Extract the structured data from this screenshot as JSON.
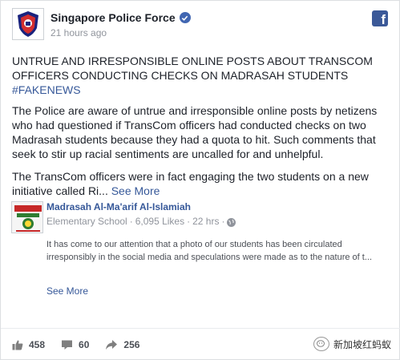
{
  "post": {
    "page_name": "Singapore Police Force",
    "timestamp": "21 hours ago",
    "headline": "UNTRUE AND IRRESPONSIBLE ONLINE POSTS ABOUT TRANSCOM OFFICERS CONDUCTING CHECKS ON MADRASAH STUDENTS",
    "hashtag": "#FAKENEWS",
    "paragraph1": "The Police are aware of untrue and irresponsible online posts by netizens who had questioned if TransCom officers had conducted checks on two Madrasah students because they had a quota to hit. Such comments that seek to stir up racial sentiments are uncalled for and unhelpful.",
    "paragraph2": "The TransCom officers were in fact engaging the two students on a new initiative called Ri...",
    "see_more": "See More",
    "icons": {
      "verified": "verified-badge-icon",
      "facebook": "facebook-logo-icon",
      "globe": "globe-icon",
      "like": "like-icon",
      "comment": "comment-icon",
      "share": "share-icon"
    },
    "colors": {
      "link": "#365899",
      "facebook_blue": "#3b5998",
      "verified": "#4267b2",
      "meta_gray": "#90949c"
    }
  },
  "shared_post": {
    "page_name": "Madrasah Al-Ma'arif Al-Islamiah",
    "category": "Elementary School",
    "likes": "6,095 Likes",
    "time": "22 hrs",
    "text": "It has come to our attention that a photo of our students has been circulated irresponsibly in the social media and speculations were made as to the nature of t...",
    "see_more": "See More"
  },
  "stats": {
    "likes": "458",
    "comments": "60",
    "shares": "256"
  },
  "watermark": {
    "text": "新加坡红蚂蚁"
  }
}
